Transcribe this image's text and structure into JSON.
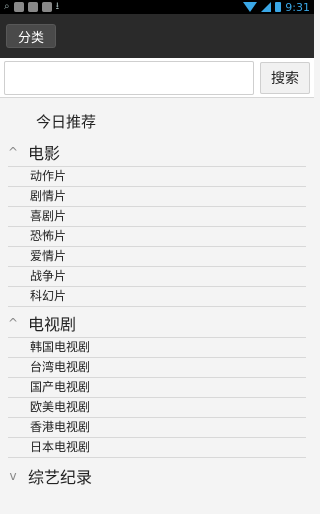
{
  "status_bar": {
    "time": "9:31"
  },
  "action_bar": {
    "category_button_label": "分类"
  },
  "search": {
    "input_value": "",
    "input_placeholder": "",
    "button_label": "搜索"
  },
  "content": {
    "today_recommendation": "今日推荐",
    "groups": [
      {
        "title": "电影",
        "expanded": true,
        "items": [
          "动作片",
          "剧情片",
          "喜剧片",
          "恐怖片",
          "爱情片",
          "战争片",
          "科幻片"
        ]
      },
      {
        "title": "电视剧",
        "expanded": true,
        "items": [
          "韩国电视剧",
          "台湾电视剧",
          "国产电视剧",
          "欧美电视剧",
          "香港电视剧",
          "日本电视剧"
        ]
      },
      {
        "title": "综艺纪录",
        "expanded": false,
        "items": []
      }
    ]
  },
  "icons": {
    "expand": "chevron-up-icon",
    "collapse": "chevron-down-icon"
  }
}
